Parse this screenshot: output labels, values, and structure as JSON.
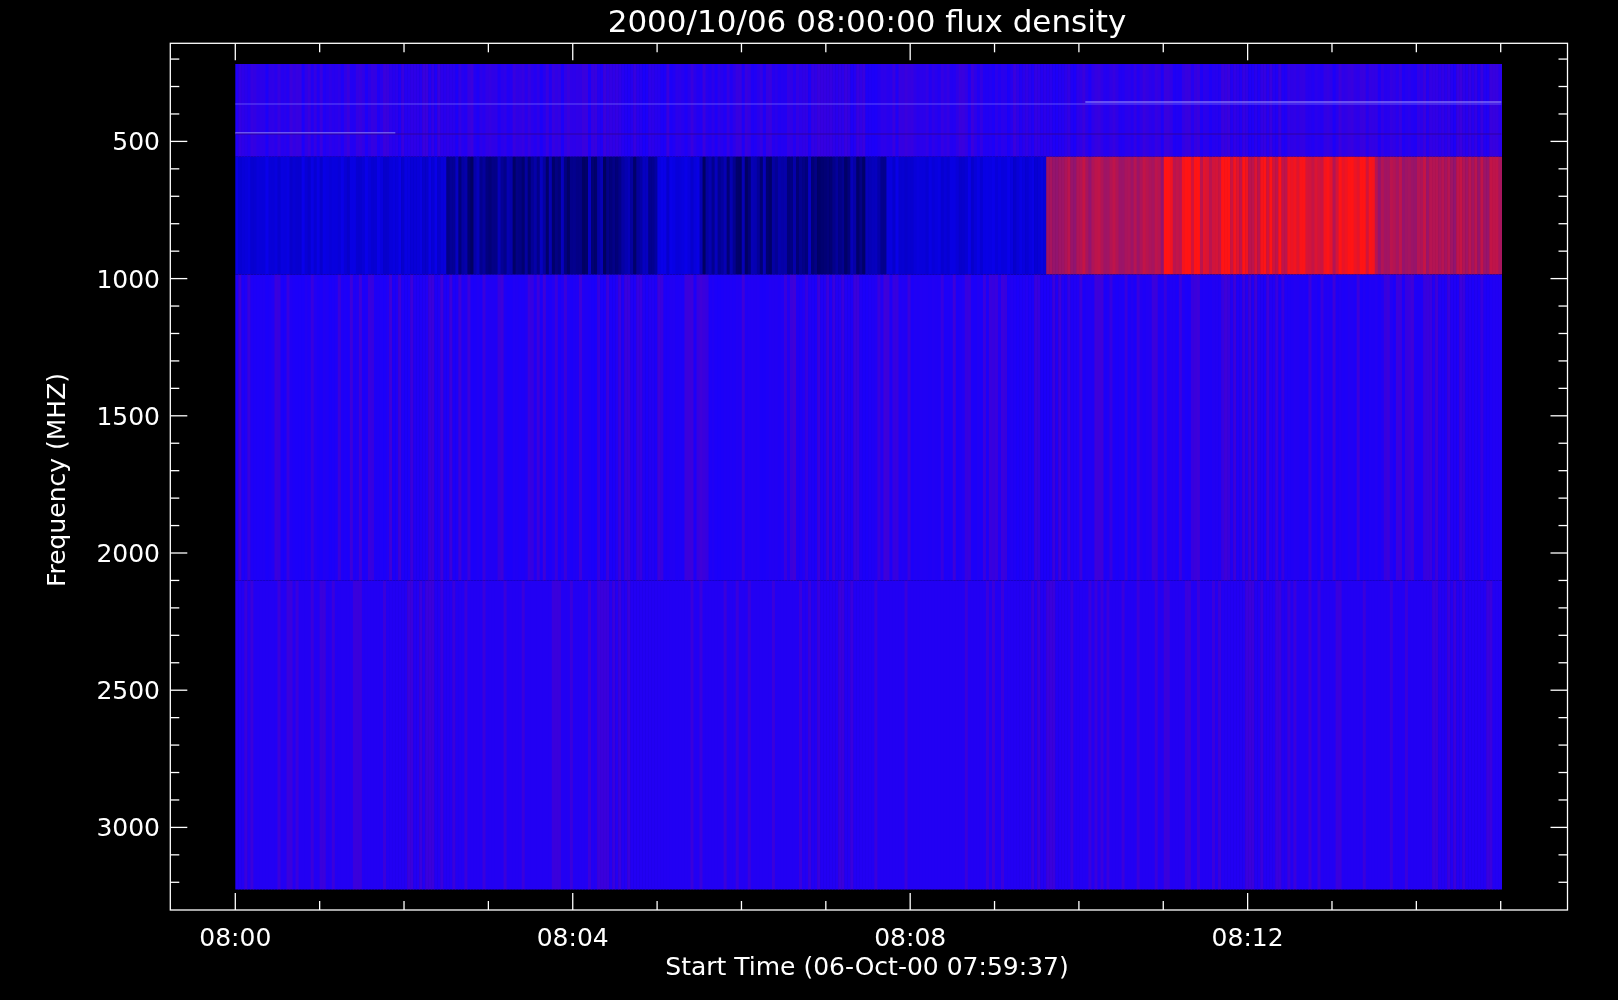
{
  "title": "2000/10/06 08:00:00 flux density",
  "xlabel": "Start Time (06-Oct-00 07:59:37)",
  "ylabel": "Frequency (MHZ)",
  "yticks": [
    "500",
    "1000",
    "1500",
    "2000",
    "2500",
    "3000"
  ],
  "xticks": [
    "08:00",
    "08:04",
    "08:08",
    "08:12"
  ]
}
